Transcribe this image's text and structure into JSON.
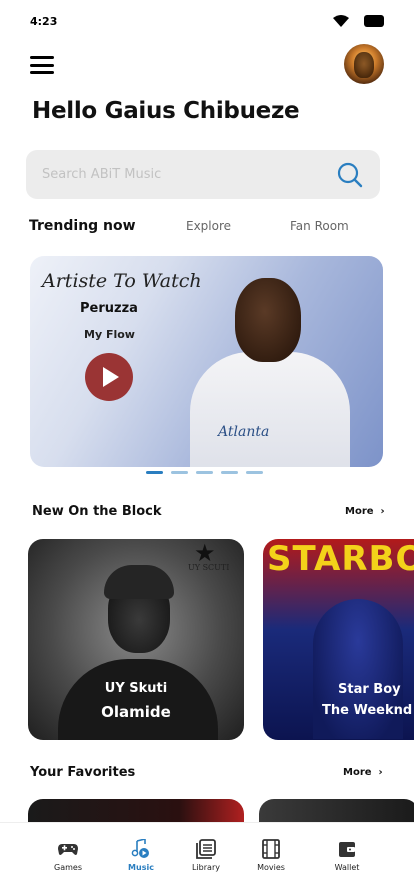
{
  "status_bar": {
    "time": "4:23"
  },
  "header": {
    "greeting": "Hello Gaius Chibueze"
  },
  "search": {
    "placeholder": "Search ABiT Music"
  },
  "tabs": [
    {
      "label": "Trending now",
      "active": true
    },
    {
      "label": "Explore",
      "active": false
    },
    {
      "label": "Fan Room",
      "active": false
    }
  ],
  "banner": {
    "tag": "Artiste To Watch",
    "artist": "Peruzza",
    "song": "My Flow",
    "shirt_text": "Atlanta",
    "slide_count": 5,
    "active_slide": 1
  },
  "new_on_block": {
    "title": "New On the Block",
    "more_label": "More",
    "cards": [
      {
        "title": "UY Skuti",
        "artist": "Olamide",
        "cover_text": "UY SCUTI"
      },
      {
        "title": "Star Boy",
        "artist": "The Weeknd",
        "cover_text": "STARBO"
      }
    ]
  },
  "favorites": {
    "title": "Your Favorites",
    "more_label": "More"
  },
  "bottom_nav": [
    {
      "label": "Games",
      "icon": "gamepad-icon",
      "active": false
    },
    {
      "label": "Music",
      "icon": "music-icon",
      "active": true
    },
    {
      "label": "Library",
      "icon": "library-icon",
      "active": false
    },
    {
      "label": "Movies",
      "icon": "film-icon",
      "active": false
    },
    {
      "label": "Wallet",
      "icon": "wallet-icon",
      "active": false
    }
  ],
  "colors": {
    "accent": "#2a7ec0",
    "play_button": "#9a3434",
    "search_bg": "#ececec"
  }
}
